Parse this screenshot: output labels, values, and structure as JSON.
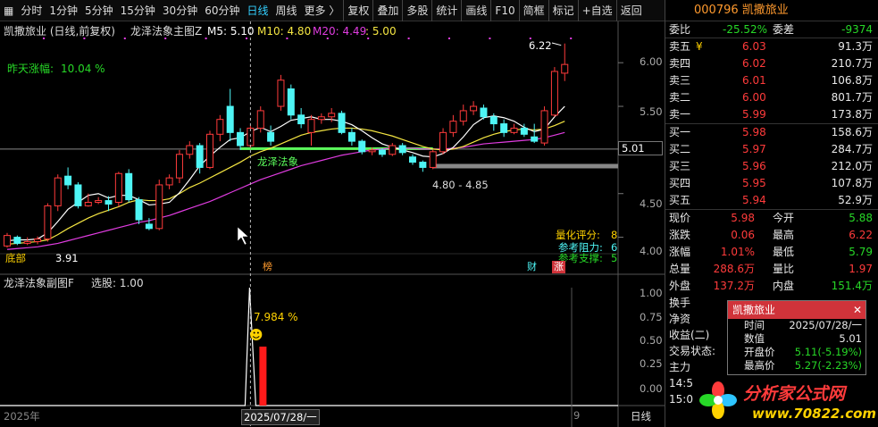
{
  "toolbar": {
    "periods": [
      "分时",
      "1分钟",
      "5分钟",
      "15分钟",
      "30分钟",
      "60分钟",
      "日线",
      "周线",
      "更多 〉"
    ],
    "active_period": "日线",
    "tools": [
      "复权",
      "叠加",
      "多股",
      "统计",
      "画线",
      "F10",
      "简框",
      "标记",
      "+自选",
      "返回"
    ]
  },
  "main_chart": {
    "name": "凯撒旅业 (日线,前复权)",
    "indicator": "龙泽法象主图Z",
    "ma5_label": "M5: 5.10",
    "ma10_label": "M10: 4.80",
    "ma20_label": "M20: 4.49",
    "ma20_extra": ": 5.00",
    "yesterday_gain_label": "昨天涨幅:",
    "yesterday_gain_value": "10.04 %",
    "yaxis_ticks": [
      "6.00",
      "5.50",
      "5.01",
      "4.50",
      "4.00"
    ],
    "current_price_tag": "5.01",
    "high_mark": "6.22",
    "low_mark": "3.91",
    "zone_label": "龙泽法象",
    "range_label": "4.80 - 4.85",
    "bottom_left_label": "底部",
    "quant_score_label": "量化评分:",
    "quant_score_value": "8",
    "resistance_label": "参考阻力:",
    "resistance_value": "6",
    "support_label": "参考支撑:",
    "support_value": "5",
    "event_tags": [
      "榜",
      "财",
      "涨"
    ],
    "colors": {
      "up": "#ff3b3b",
      "down": "#4ef5f5",
      "ma5": "#ffffff",
      "ma10": "#f5e642",
      "ma20": "#e03ce0",
      "zone": "#5cff5c"
    }
  },
  "sub_chart": {
    "indicator": "龙泽法象副图F",
    "select_label": "选股: 1.00",
    "peak_label": "7.984 %",
    "face_icon": "smiley-icon",
    "yaxis_ticks": [
      "1.00",
      "0.75",
      "0.50",
      "0.25",
      "0.00"
    ]
  },
  "date_axis": {
    "left_label": "2025年",
    "cursor_label": "2025/07/28/一",
    "right_label": "9",
    "period_button": "日线"
  },
  "quote_panel": {
    "code_name": "000796 凯撒旅业",
    "weibi_label": "委比",
    "weibi_value": "-25.52%",
    "weicha_label": "委差",
    "weicha_value": "-9374",
    "sell": [
      {
        "label": "卖五",
        "price": "6.03",
        "vol": "91.3万",
        "yen": "¥"
      },
      {
        "label": "卖四",
        "price": "6.02",
        "vol": "210.7万"
      },
      {
        "label": "卖三",
        "price": "6.01",
        "vol": "106.8万"
      },
      {
        "label": "卖二",
        "price": "6.00",
        "vol": "801.7万"
      },
      {
        "label": "卖一",
        "price": "5.99",
        "vol": "173.8万"
      }
    ],
    "buy": [
      {
        "label": "买一",
        "price": "5.98",
        "vol": "158.6万"
      },
      {
        "label": "买二",
        "price": "5.97",
        "vol": "284.7万"
      },
      {
        "label": "买三",
        "price": "5.96",
        "vol": "212.0万"
      },
      {
        "label": "买四",
        "price": "5.95",
        "vol": "107.8万"
      },
      {
        "label": "买五",
        "price": "5.94",
        "vol": "52.9万"
      }
    ],
    "stats": [
      {
        "l1": "现价",
        "v1": "5.98",
        "l2": "今开",
        "v2": "5.88"
      },
      {
        "l1": "涨跌",
        "v1": "0.06",
        "l2": "最高",
        "v2": "6.22"
      },
      {
        "l1": "涨幅",
        "v1": "1.01%",
        "l2": "最低",
        "v2": "5.79"
      },
      {
        "l1": "总量",
        "v1": "288.6万",
        "l2": "量比",
        "v2": "1.97"
      },
      {
        "l1": "外盘",
        "v1": "137.2万",
        "l2": "内盘",
        "v2": "151.4万"
      }
    ],
    "extra_labels": [
      "换手",
      "净资",
      "收益(二)",
      "交易状态:",
      "主力",
      "14:5",
      "15:0"
    ]
  },
  "popup": {
    "title": "凯撒旅业",
    "rows": [
      {
        "k": "时间",
        "v": "2025/07/28/一"
      },
      {
        "k": "数值",
        "v": "5.01"
      },
      {
        "k": "开盘价",
        "v": "5.11(-5.19%)"
      },
      {
        "k": "最高价",
        "v": "5.27(-2.23%)"
      }
    ]
  },
  "watermark": {
    "cn": "分析家公式网",
    "url": "www.70822.com"
  },
  "chart_data": {
    "type": "candlestick",
    "title": "凯撒旅业 (日线,前复权)",
    "ylim": [
      3.75,
      6.35
    ],
    "candles": [
      {
        "o": 3.9,
        "c": 4.02,
        "h": 4.05,
        "l": 3.88
      },
      {
        "o": 4.0,
        "c": 3.93,
        "h": 4.02,
        "l": 3.91
      },
      {
        "o": 3.93,
        "c": 3.95,
        "h": 4.0,
        "l": 3.91
      },
      {
        "o": 3.95,
        "c": 3.98,
        "h": 4.01,
        "l": 3.92
      },
      {
        "o": 3.98,
        "c": 4.36,
        "h": 4.39,
        "l": 3.95
      },
      {
        "o": 4.36,
        "c": 4.68,
        "h": 4.72,
        "l": 4.3
      },
      {
        "o": 4.7,
        "c": 4.6,
        "h": 4.8,
        "l": 4.55
      },
      {
        "o": 4.6,
        "c": 4.36,
        "h": 4.63,
        "l": 4.33
      },
      {
        "o": 4.36,
        "c": 4.4,
        "h": 4.5,
        "l": 4.35
      },
      {
        "o": 4.4,
        "c": 4.42,
        "h": 4.46,
        "l": 4.38
      },
      {
        "o": 4.42,
        "c": 4.38,
        "h": 4.47,
        "l": 4.3
      },
      {
        "o": 4.4,
        "c": 4.73,
        "h": 4.75,
        "l": 4.35
      },
      {
        "o": 4.73,
        "c": 4.43,
        "h": 4.78,
        "l": 4.4
      },
      {
        "o": 4.43,
        "c": 4.2,
        "h": 4.46,
        "l": 4.15
      },
      {
        "o": 4.15,
        "c": 4.1,
        "h": 4.22,
        "l": 4.08
      },
      {
        "o": 4.1,
        "c": 4.6,
        "h": 4.66,
        "l": 4.08
      },
      {
        "o": 4.6,
        "c": 4.68,
        "h": 4.72,
        "l": 4.55
      },
      {
        "o": 4.68,
        "c": 4.95,
        "h": 5.0,
        "l": 4.62
      },
      {
        "o": 4.95,
        "c": 5.05,
        "h": 5.1,
        "l": 4.9
      },
      {
        "o": 5.05,
        "c": 4.8,
        "h": 5.08,
        "l": 4.73
      },
      {
        "o": 4.8,
        "c": 5.18,
        "h": 5.22,
        "l": 4.78
      },
      {
        "o": 5.18,
        "c": 5.35,
        "h": 5.4,
        "l": 5.1
      },
      {
        "o": 5.5,
        "c": 5.2,
        "h": 5.7,
        "l": 5.1
      },
      {
        "o": 5.2,
        "c": 5.05,
        "h": 5.25,
        "l": 5.0
      },
      {
        "o": 5.05,
        "c": 5.25,
        "h": 5.28,
        "l": 5.02
      },
      {
        "o": 5.25,
        "c": 5.45,
        "h": 5.5,
        "l": 5.2
      },
      {
        "o": 5.2,
        "c": 5.1,
        "h": 5.28,
        "l": 5.05
      },
      {
        "o": 5.5,
        "c": 5.8,
        "h": 5.86,
        "l": 5.45
      },
      {
        "o": 5.7,
        "c": 5.4,
        "h": 5.75,
        "l": 5.35
      },
      {
        "o": 5.4,
        "c": 5.3,
        "h": 5.48,
        "l": 5.25
      },
      {
        "o": 5.2,
        "c": 5.35,
        "h": 5.4,
        "l": 5.05
      },
      {
        "o": 5.35,
        "c": 5.38,
        "h": 5.42,
        "l": 5.3
      },
      {
        "o": 5.38,
        "c": 5.42,
        "h": 5.48,
        "l": 5.32
      },
      {
        "o": 5.42,
        "c": 5.2,
        "h": 5.45,
        "l": 5.18
      },
      {
        "o": 5.2,
        "c": 5.1,
        "h": 5.25,
        "l": 5.05
      },
      {
        "o": 5.1,
        "c": 4.98,
        "h": 5.12,
        "l": 4.95
      },
      {
        "o": 4.98,
        "c": 5.0,
        "h": 5.03,
        "l": 4.94
      },
      {
        "o": 5.0,
        "c": 4.95,
        "h": 5.02,
        "l": 4.92
      },
      {
        "o": 4.95,
        "c": 5.05,
        "h": 5.08,
        "l": 4.93
      },
      {
        "o": 5.05,
        "c": 4.97,
        "h": 5.08,
        "l": 4.94
      },
      {
        "o": 4.92,
        "c": 4.86,
        "h": 4.95,
        "l": 4.83
      },
      {
        "o": 4.86,
        "c": 4.8,
        "h": 4.88,
        "l": 4.75
      },
      {
        "o": 4.8,
        "c": 4.98,
        "h": 5.0,
        "l": 4.78
      },
      {
        "o": 4.98,
        "c": 5.2,
        "h": 5.25,
        "l": 4.95
      },
      {
        "o": 5.2,
        "c": 5.33,
        "h": 5.4,
        "l": 5.15
      },
      {
        "o": 5.33,
        "c": 5.45,
        "h": 5.52,
        "l": 5.28
      },
      {
        "o": 5.45,
        "c": 5.5,
        "h": 5.56,
        "l": 5.4
      },
      {
        "o": 5.48,
        "c": 5.38,
        "h": 5.52,
        "l": 5.35
      },
      {
        "o": 5.38,
        "c": 5.3,
        "h": 5.42,
        "l": 5.22
      },
      {
        "o": 5.3,
        "c": 5.2,
        "h": 5.35,
        "l": 5.15
      },
      {
        "o": 5.2,
        "c": 5.25,
        "h": 5.3,
        "l": 5.18
      },
      {
        "o": 5.25,
        "c": 5.18,
        "h": 5.3,
        "l": 5.15
      },
      {
        "o": 5.15,
        "c": 5.1,
        "h": 5.3,
        "l": 5.08
      },
      {
        "o": 5.08,
        "c": 5.45,
        "h": 5.5,
        "l": 5.05
      },
      {
        "o": 5.4,
        "c": 5.9,
        "h": 5.95,
        "l": 5.38
      },
      {
        "o": 5.88,
        "c": 5.98,
        "h": 6.22,
        "l": 5.79
      }
    ],
    "ma5": [
      3.96,
      3.97,
      3.97,
      3.98,
      4.05,
      4.18,
      4.32,
      4.4,
      4.48,
      4.5,
      4.45,
      4.48,
      4.48,
      4.43,
      4.37,
      4.38,
      4.4,
      4.51,
      4.66,
      4.82,
      4.93,
      5.03,
      5.12,
      5.14,
      5.21,
      5.26,
      5.21,
      5.27,
      5.34,
      5.36,
      5.38,
      5.35,
      5.35,
      5.33,
      5.29,
      5.22,
      5.14,
      5.07,
      5.03,
      5.0,
      4.97,
      4.93,
      4.92,
      4.96,
      5.03,
      5.15,
      5.29,
      5.37,
      5.39,
      5.37,
      5.33,
      5.26,
      5.21,
      5.24,
      5.38,
      5.5
    ],
    "ma10": [
      3.92,
      3.93,
      3.94,
      3.95,
      3.97,
      4.03,
      4.1,
      4.16,
      4.22,
      4.27,
      4.31,
      4.35,
      4.4,
      4.43,
      4.42,
      4.42,
      4.44,
      4.5,
      4.57,
      4.62,
      4.68,
      4.74,
      4.8,
      4.86,
      4.93,
      4.98,
      5.02,
      5.07,
      5.12,
      5.17,
      5.2,
      5.22,
      5.24,
      5.25,
      5.25,
      5.24,
      5.22,
      5.19,
      5.16,
      5.12,
      5.08,
      5.04,
      5.01,
      5.0,
      5.01,
      5.04,
      5.09,
      5.14,
      5.18,
      5.21,
      5.23,
      5.24,
      5.23,
      5.24,
      5.28,
      5.33
    ],
    "ma20": [
      3.86,
      3.87,
      3.88,
      3.89,
      3.91,
      3.93,
      3.96,
      3.99,
      4.02,
      4.05,
      4.08,
      4.11,
      4.14,
      4.17,
      4.19,
      4.22,
      4.25,
      4.29,
      4.33,
      4.37,
      4.41,
      4.46,
      4.51,
      4.56,
      4.61,
      4.66,
      4.7,
      4.74,
      4.78,
      4.82,
      4.85,
      4.88,
      4.91,
      4.94,
      4.96,
      4.98,
      5.0,
      5.01,
      5.02,
      5.02,
      5.02,
      5.01,
      5.01,
      5.01,
      5.02,
      5.03,
      5.05,
      5.07,
      5.08,
      5.09,
      5.1,
      5.11,
      5.12,
      5.14,
      5.17,
      5.2
    ]
  }
}
